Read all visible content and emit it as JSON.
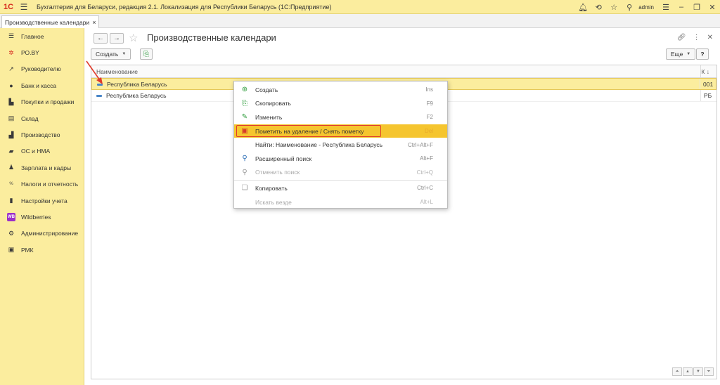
{
  "titlebar": {
    "logo": "1С",
    "title": "Бухгалтерия для Беларуси, редакция 2.1. Локализация для Республики Беларусь   (1С:Предприятие)",
    "user": "admin"
  },
  "tabs": [
    {
      "label": "Производственные календари",
      "close": "×"
    }
  ],
  "sidebar": {
    "items": [
      {
        "label": "Главное",
        "icon": "menu-lines-icon"
      },
      {
        "label": "РО.BY",
        "icon": "ro-by-icon"
      },
      {
        "label": "Руководителю",
        "icon": "trend-icon"
      },
      {
        "label": "Банк и касса",
        "icon": "coin-icon"
      },
      {
        "label": "Покупки и продажи",
        "icon": "cart-icon"
      },
      {
        "label": "Склад",
        "icon": "warehouse-icon"
      },
      {
        "label": "Производство",
        "icon": "factory-icon"
      },
      {
        "label": "ОС и НМА",
        "icon": "truck-icon"
      },
      {
        "label": "Зарплата и кадры",
        "icon": "person-icon"
      },
      {
        "label": "Налоги и отчетность",
        "icon": "tax-icon"
      },
      {
        "label": "Настройки учета",
        "icon": "book-icon"
      },
      {
        "label": "Wildberries",
        "icon": "wb-icon",
        "badge": "WB"
      },
      {
        "label": "Администрирование",
        "icon": "gear-icon"
      },
      {
        "label": "РМК",
        "icon": "register-icon"
      }
    ]
  },
  "main": {
    "title": "Производственные календари",
    "create_label": "Создать",
    "more_label": "Еще",
    "help_label": "?",
    "table": {
      "col_name": "Наименование",
      "col_code": "К",
      "sort_marker": "↓",
      "rows": [
        {
          "name": "Республика Беларусь",
          "code": "001",
          "selected": true
        },
        {
          "name": "Республика Беларусь",
          "code": "РБ",
          "selected": false
        }
      ]
    }
  },
  "context_menu": {
    "items": [
      {
        "label": "Создать",
        "shortcut": "Ins",
        "icon": "plus-circle-icon"
      },
      {
        "label": "Скопировать",
        "shortcut": "F9",
        "icon": "copy-doc-icon"
      },
      {
        "label": "Изменить",
        "shortcut": "F2",
        "icon": "pencil-icon"
      },
      {
        "label": "Пометить на удаление / Снять пометку",
        "shortcut": "Del",
        "icon": "delete-mark-icon"
      },
      {
        "label": "Найти: Наименование - Республика Беларусь",
        "shortcut": "Ctrl+Alt+F",
        "icon": ""
      },
      {
        "label": "Расширенный поиск",
        "shortcut": "Alt+F",
        "icon": "search-icon"
      },
      {
        "label": "Отменить поиск",
        "shortcut": "Ctrl+Q",
        "icon": "cancel-search-icon"
      },
      {
        "label": "Копировать",
        "shortcut": "Ctrl+C",
        "icon": "clipboard-icon"
      },
      {
        "label": "Искать везде",
        "shortcut": "Alt+L",
        "icon": ""
      }
    ]
  },
  "colors": {
    "sidebar_bg": "#fbed9e",
    "highlight": "#f5c52f",
    "annotation_red": "#e03a2a",
    "logo_red": "#d6271c"
  }
}
